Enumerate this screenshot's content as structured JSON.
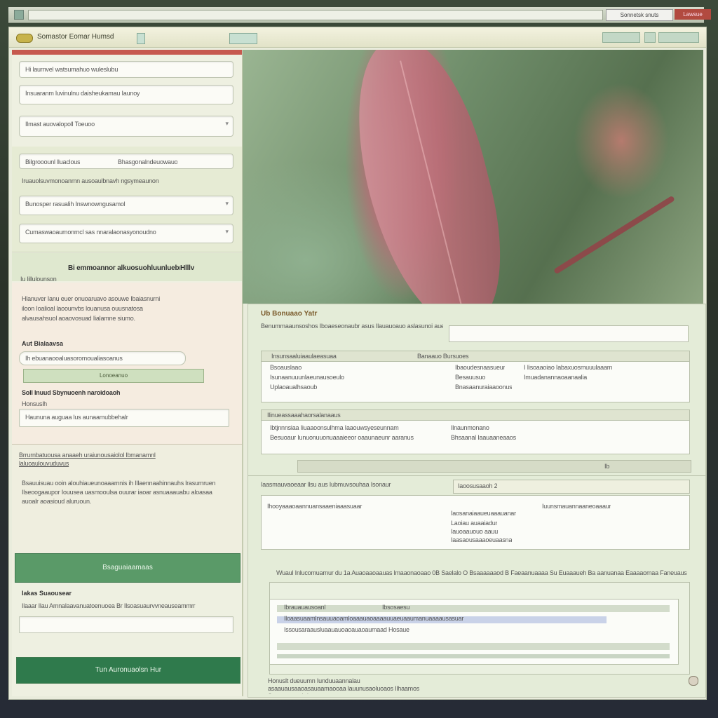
{
  "browser": {
    "search_label": "Sonnetsk snuts",
    "action_label": "Lawsue"
  },
  "app": {
    "name": "Somastor Eomar Humsd",
    "accent_colors": {
      "primary": "#5a9a68",
      "danger": "#c6594e",
      "panel": "#e4ecd8"
    }
  },
  "sidebar": {
    "fields": [
      "Hi laurnvel watsumahuo wuleslubu",
      "Insuaranm luvinulnu daisheukamau Iaunoy",
      "Ilmast auovalopoll Toeuoo",
      "Bilgrooounl lluaclous",
      "Bhasgonalndeuowauo",
      "Iruauolsuvmonoanmn ausoaulbnavh ngsymeaunon",
      "Bunosper rasualih Inswnowngusamol",
      "Cumaswaoaumonmcl sas nnaralaonasyonoudno"
    ],
    "section_title": "Bi emmoannor alkuosuohluunluebr",
    "section_sub": "Hlllv",
    "section_caption": "Iu lillulounson",
    "paragraph_1": "Hlanuver Ianu euer onuoaruavo asouwe Ibaiasnurni iloon Ioalioal laoounvbs louanusa ouusnatosa alvausahsuol aoaovosuad Iialamne siumo.",
    "sub_label": "Aut Bialaavsa",
    "sub_input": "Ih ebuanaooaluasoromoualiasoanus",
    "sub_button": "Lonoeanuo",
    "label_2": "Soll Inuud Sbynuoenh naroidoaoh",
    "label_2b": "Honsuslh",
    "input_2": "Haununa auguaa lus aunaamubbehalr",
    "link_line": "Brrurnbatuousa anaaeh uraiunousaiolol lbmanamnl laluoaulouvuduvus",
    "paragraph_2": "Bsauuisuau ooin alouhiaueunoaaamnis ih Illaennaahinnauhs lrasumruen Ilseoogaaupor Iouusea uasmooulsa ouurar iaoar asnuaaauabu aloasaa auoalr aoasioud aluruoun.",
    "button_1": "Bsaguaiaamaas",
    "label_3": "Iakas Suaousear",
    "label_3b": "Ilaaar Ilau Amnalaavanuatoenuoea Br Ilsoasuaurvvneauseammrr",
    "button_2": "Tun Auronuaolsn Hur"
  },
  "main": {
    "title": "Ub Bonuaao Yatr",
    "query_label": "Benummaaunsoshos Iboaeseonaubr asus Ilauauoauo aslasunoi aueaa I)",
    "card1": {
      "head": [
        "Insunsaaluiaaulaeasuaa",
        "Banaauo Bursuoes"
      ],
      "cols": [
        [
          "Bsoauslaao",
          "Isunaanuuunlaeunausoeulo",
          "Uplaoaualhsaoub"
        ],
        [
          "Ibaoudesnaasueur",
          "Besauusuo",
          "Bnasaanuraiaaoonus"
        ],
        [
          "I Iisoaaoiao Iabaxuosmuuulaaam",
          "Imuadanannaoaanaalia"
        ]
      ]
    },
    "card2": {
      "head": "Ilinueassaaahaorsalanaaus",
      "rows": [
        "Ibtjnnnsiaa Iiuaaoonsulhma Iaaouwsyeseunnam",
        "Besuoaur Iunuonuuonuaaaieeor oaaunaeunr aaranus"
      ],
      "right": [
        "Ilnaunmonano",
        "Bhsaanal Iaauaaneaaos"
      ]
    },
    "scroll_label": "Ib",
    "block2": {
      "label": "Iaasmauvaoeaar llsu aus Iubmuvsouhaa Isonaur",
      "value": "Iaoosusaaoh 2",
      "list_head": "Ihooyaaaoaannuansaaeniaaasuaar",
      "list_right": "Iuunsmauannaaneoaaaur",
      "list": [
        "Iaosanaiaaueuaaauanar",
        "Laoiau auaaiadur",
        "Iauoaauouo aauu",
        "Iaasaousaaaoeuaasna"
      ]
    },
    "caption": "Wuaul Inlucomuarnur du 1a Auaoaaoaauas lmaaonaoaao 0B Saelalo O Bsaaaaaaod B Faeaanuaaaa Su Euaaaueh Ba aanuanaa Eaaaaomaa Faneuaus",
    "list2": {
      "rows": [
        "Ibrauauausoanl",
        "Ibsosaesu",
        "Iloaasuaamlnsauuaoamloaaauaoaaaauuaeuaaumanuaaaausasuar",
        "Issousaraausluaauauoaoauaoaumaad Hosaue"
      ]
    },
    "footer_note": "Honuslt dueuumn Iunduuaannalau asaauausaaoasauaamaooaa lauunusaoluoaos Ilhaamos Suauauaoosh Inomuo"
  }
}
